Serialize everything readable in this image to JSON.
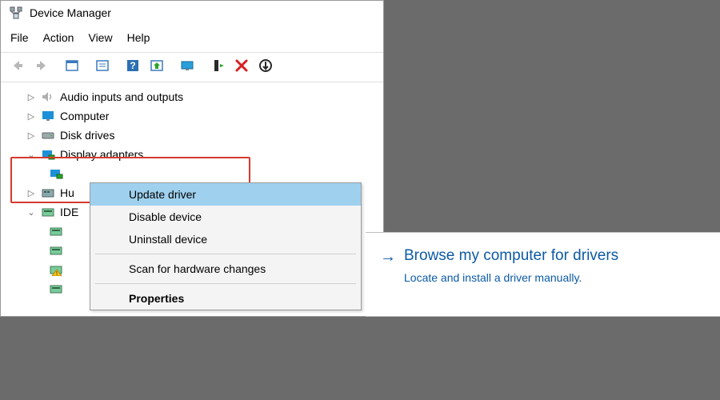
{
  "window": {
    "title": "Device Manager"
  },
  "menus": {
    "file": "File",
    "action": "Action",
    "view": "View",
    "help": "Help"
  },
  "tree": {
    "audio": "Audio inputs and outputs",
    "computer": "Computer",
    "disk": "Disk drives",
    "display": "Display adapters",
    "hu": "Hu",
    "ide": "IDE"
  },
  "context": {
    "update": "Update driver",
    "disable": "Disable device",
    "uninstall": "Uninstall device",
    "scan": "Scan for hardware changes",
    "properties": "Properties"
  },
  "browse": {
    "title": "Browse my computer for drivers",
    "subtitle": "Locate and install a driver manually."
  }
}
